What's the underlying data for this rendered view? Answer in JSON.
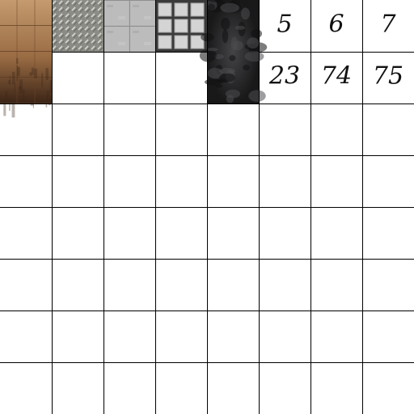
{
  "atlas": {
    "grid": {
      "columns": 8,
      "rows": 8
    },
    "line_color": "#000000",
    "background": "#ffffff",
    "textures": [
      {
        "name": "wood-planks-texture",
        "col": 0,
        "row": 0,
        "col_span": 1,
        "row_span": 2,
        "colors": [
          "#b58a60",
          "#7a5232",
          "#3b2416"
        ]
      },
      {
        "name": "diamond-plate-metal-texture",
        "col": 1,
        "row": 0,
        "col_span": 1,
        "row_span": 1,
        "colors": [
          "#8c8c86",
          "#c9c9c2",
          "#5e5e58"
        ]
      },
      {
        "name": "concrete-tiles-texture",
        "col": 2,
        "row": 0,
        "col_span": 1,
        "row_span": 1,
        "colors": [
          "#b4b4b4",
          "#8f8f8f",
          "#cfcfcf"
        ]
      },
      {
        "name": "steel-grate-texture",
        "col": 3,
        "row": 0,
        "col_span": 1,
        "row_span": 1,
        "colors": [
          "#d4d4d4",
          "#3a3a3a",
          "#9a9a9a"
        ]
      },
      {
        "name": "dark-rock-texture",
        "col": 4,
        "row": 0,
        "col_span": 1,
        "row_span": 2,
        "colors": [
          "#2a2a2c",
          "#4d4d50",
          "#111112"
        ]
      }
    ],
    "handwritten_cells": [
      {
        "col": 5,
        "row": 0,
        "label": "5"
      },
      {
        "col": 6,
        "row": 0,
        "label": "6"
      },
      {
        "col": 7,
        "row": 0,
        "label": "7"
      },
      {
        "col": 5,
        "row": 1,
        "label": "23"
      },
      {
        "col": 6,
        "row": 1,
        "label": "74"
      },
      {
        "col": 7,
        "row": 1,
        "label": "75"
      }
    ]
  }
}
